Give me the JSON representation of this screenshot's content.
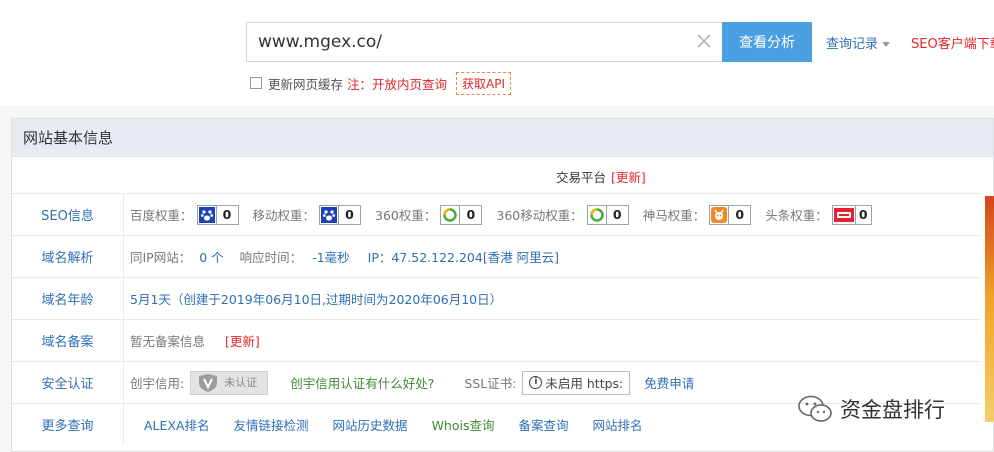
{
  "search": {
    "value": "www.mgex.co/",
    "button_label": "查看分析",
    "history_label": "查询记录",
    "client_label": "SEO客户端下载"
  },
  "cache": {
    "label": "更新网页缓存",
    "note": "注：开放内页查询",
    "api_label": "获取API"
  },
  "panel": {
    "title": "网站基本信息",
    "trade_text": "交易平台",
    "trade_update": "[更新]"
  },
  "seo": {
    "label": "SEO信息",
    "weights": [
      {
        "name": "百度权重：",
        "icon": "baidu-paw-icon",
        "value": "0"
      },
      {
        "name": "移动权重：",
        "icon": "baidu-paw-icon",
        "value": "0"
      },
      {
        "name": "360权重：",
        "icon": "360-ring-icon",
        "value": "0"
      },
      {
        "name": "360移动权重：",
        "icon": "360-ring-icon",
        "value": "0"
      },
      {
        "name": "神马权重：",
        "icon": "shenma-horse-icon",
        "value": "0"
      },
      {
        "name": "头条权重：",
        "icon": "toutiao-icon",
        "value": "0"
      }
    ]
  },
  "dns": {
    "label": "域名解析",
    "same_ip_label": "同IP网站：",
    "same_ip_value": "0 个",
    "response_label": "响应时间：",
    "response_value": "-1毫秒",
    "ip_text": "IP：47.52.122.204[香港 阿里云]"
  },
  "age": {
    "label": "域名年龄",
    "value": "5月1天（创建于2019年06月10日,过期时间为2020年06月10日）"
  },
  "icp": {
    "label": "域名备案",
    "value": "暂无备案信息",
    "update": "[更新]"
  },
  "security": {
    "label": "安全认证",
    "credit_label": "创宇信用:",
    "cert_text": "未认证",
    "credit_link": "创宇信用认证有什么好处?",
    "ssl_label": "SSL证书:",
    "ssl_value": "未启用 https:",
    "ssl_apply": "免费申请"
  },
  "more": {
    "label": "更多查询",
    "links": [
      "ALEXA排名",
      "友情链接检测",
      "网站历史数据",
      "Whois查询",
      "备案查询",
      "网站排名"
    ]
  },
  "watermark": "资金盘排行",
  "colors": {
    "accent_blue": "#4a9fe3",
    "link_blue": "#2f6fb5",
    "alert_red": "#e4262c",
    "link_green": "#3c8b2f"
  }
}
